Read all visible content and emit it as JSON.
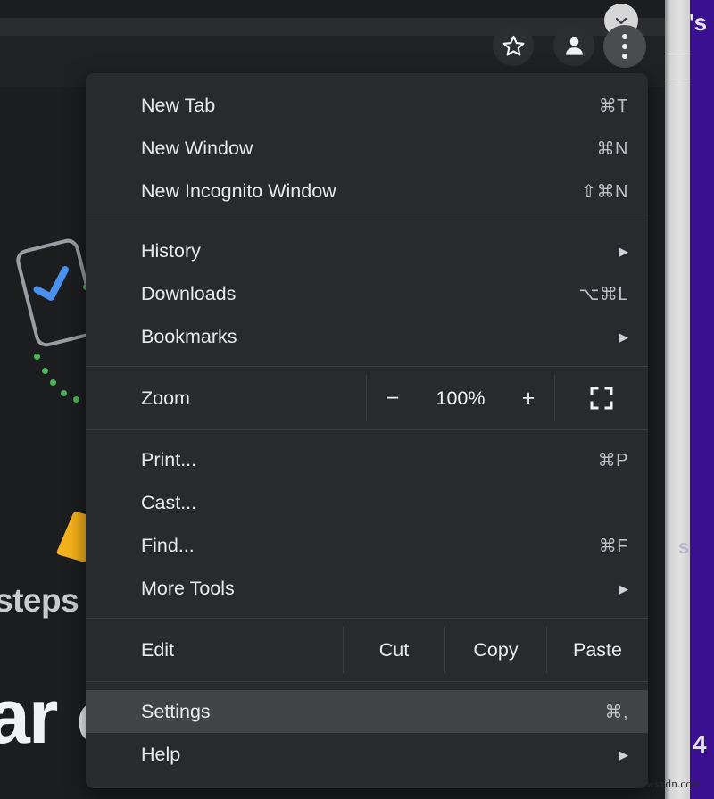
{
  "window": {
    "page_bg": "#1c1d1f",
    "toolbar_bg": "#202124",
    "menu_bg": "#292a2d",
    "menu_highlight": "#424346",
    "accent_purple": "#3a1091",
    "accent_yellow": "#f5b21c",
    "accent_green": "#49b35a",
    "accent_blue": "#4a90ee"
  },
  "toolbar": {
    "bookmark_star": "star-outline",
    "profile_avatar": "person",
    "overflow_menu": "three-dots-vertical"
  },
  "page_content": {
    "steps_text": "steps",
    "headline_fragment": "ar o",
    "purple_fragment_top": "'s",
    "purple_fragment_mid": "s",
    "purple_fragment_bottom": "4",
    "watermark": "wsxdn.com"
  },
  "menu": {
    "groups": [
      {
        "items": [
          {
            "label": "New Tab",
            "accel": "⌘T",
            "submenu": false
          },
          {
            "label": "New Window",
            "accel": "⌘N",
            "submenu": false
          },
          {
            "label": "New Incognito Window",
            "accel": "⇧⌘N",
            "submenu": false
          }
        ]
      },
      {
        "items": [
          {
            "label": "History",
            "accel": "",
            "submenu": true
          },
          {
            "label": "Downloads",
            "accel": "⌥⌘L",
            "submenu": false
          },
          {
            "label": "Bookmarks",
            "accel": "",
            "submenu": true
          }
        ]
      },
      {
        "zoom_row": {
          "label": "Zoom",
          "minus": "−",
          "value": "100%",
          "plus": "+",
          "fullscreen_icon": "fullscreen-icon"
        }
      },
      {
        "items": [
          {
            "label": "Print...",
            "accel": "⌘P",
            "submenu": false
          },
          {
            "label": "Cast...",
            "accel": "",
            "submenu": false
          },
          {
            "label": "Find...",
            "accel": "⌘F",
            "submenu": false
          },
          {
            "label": "More Tools",
            "accel": "",
            "submenu": true
          }
        ]
      },
      {
        "edit_row": {
          "label": "Edit",
          "actions": [
            "Cut",
            "Copy",
            "Paste"
          ]
        }
      },
      {
        "items": [
          {
            "label": "Settings",
            "accel": "⌘,",
            "submenu": false,
            "highlighted": true
          },
          {
            "label": "Help",
            "accel": "",
            "submenu": true
          }
        ]
      }
    ]
  }
}
